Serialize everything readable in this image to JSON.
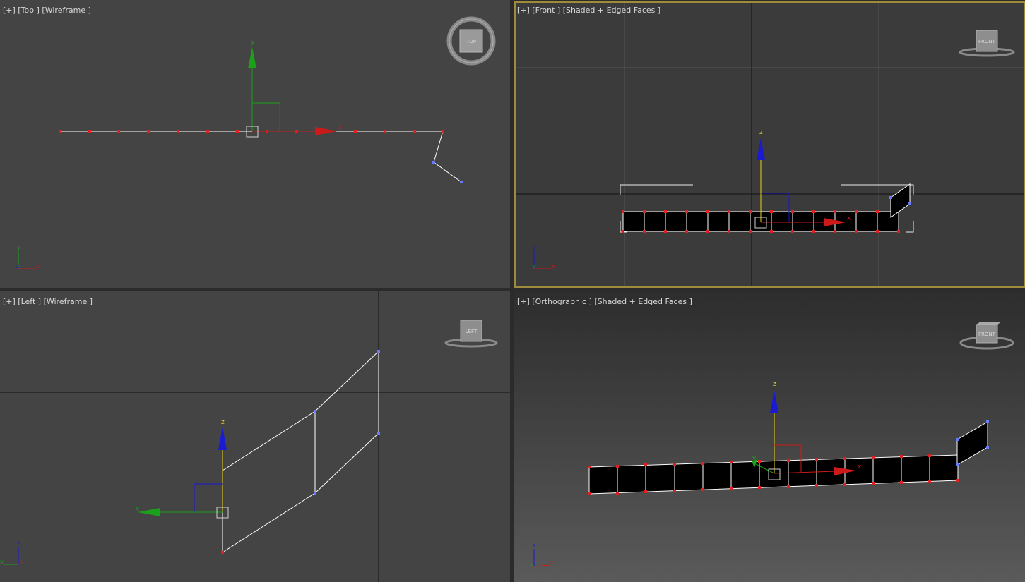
{
  "viewports": {
    "top": {
      "label": "[+] [Top ] [Wireframe ]",
      "cube_label": "TOP"
    },
    "front": {
      "label": "[+] [Front ] [Shaded + Edged Faces ]",
      "cube_label": "FRONT",
      "active": true
    },
    "left": {
      "label": "[+] [Left ] [Wireframe ]",
      "cube_label": "LEFT"
    },
    "ortho": {
      "label": "[+] [Orthographic ] [Shaded + Edged Faces ]",
      "cube_label": "FRONT"
    }
  },
  "axes": {
    "x": "x",
    "y": "y",
    "z": "z"
  },
  "colors": {
    "x_axis": "#cc1a1a",
    "y_axis": "#1aa01a",
    "z_axis": "#1a1ad2",
    "active_border": "#a08a3c",
    "vertex": "#e02020",
    "selected_vertex": "#6a7aff",
    "wire": "#ffffff"
  }
}
